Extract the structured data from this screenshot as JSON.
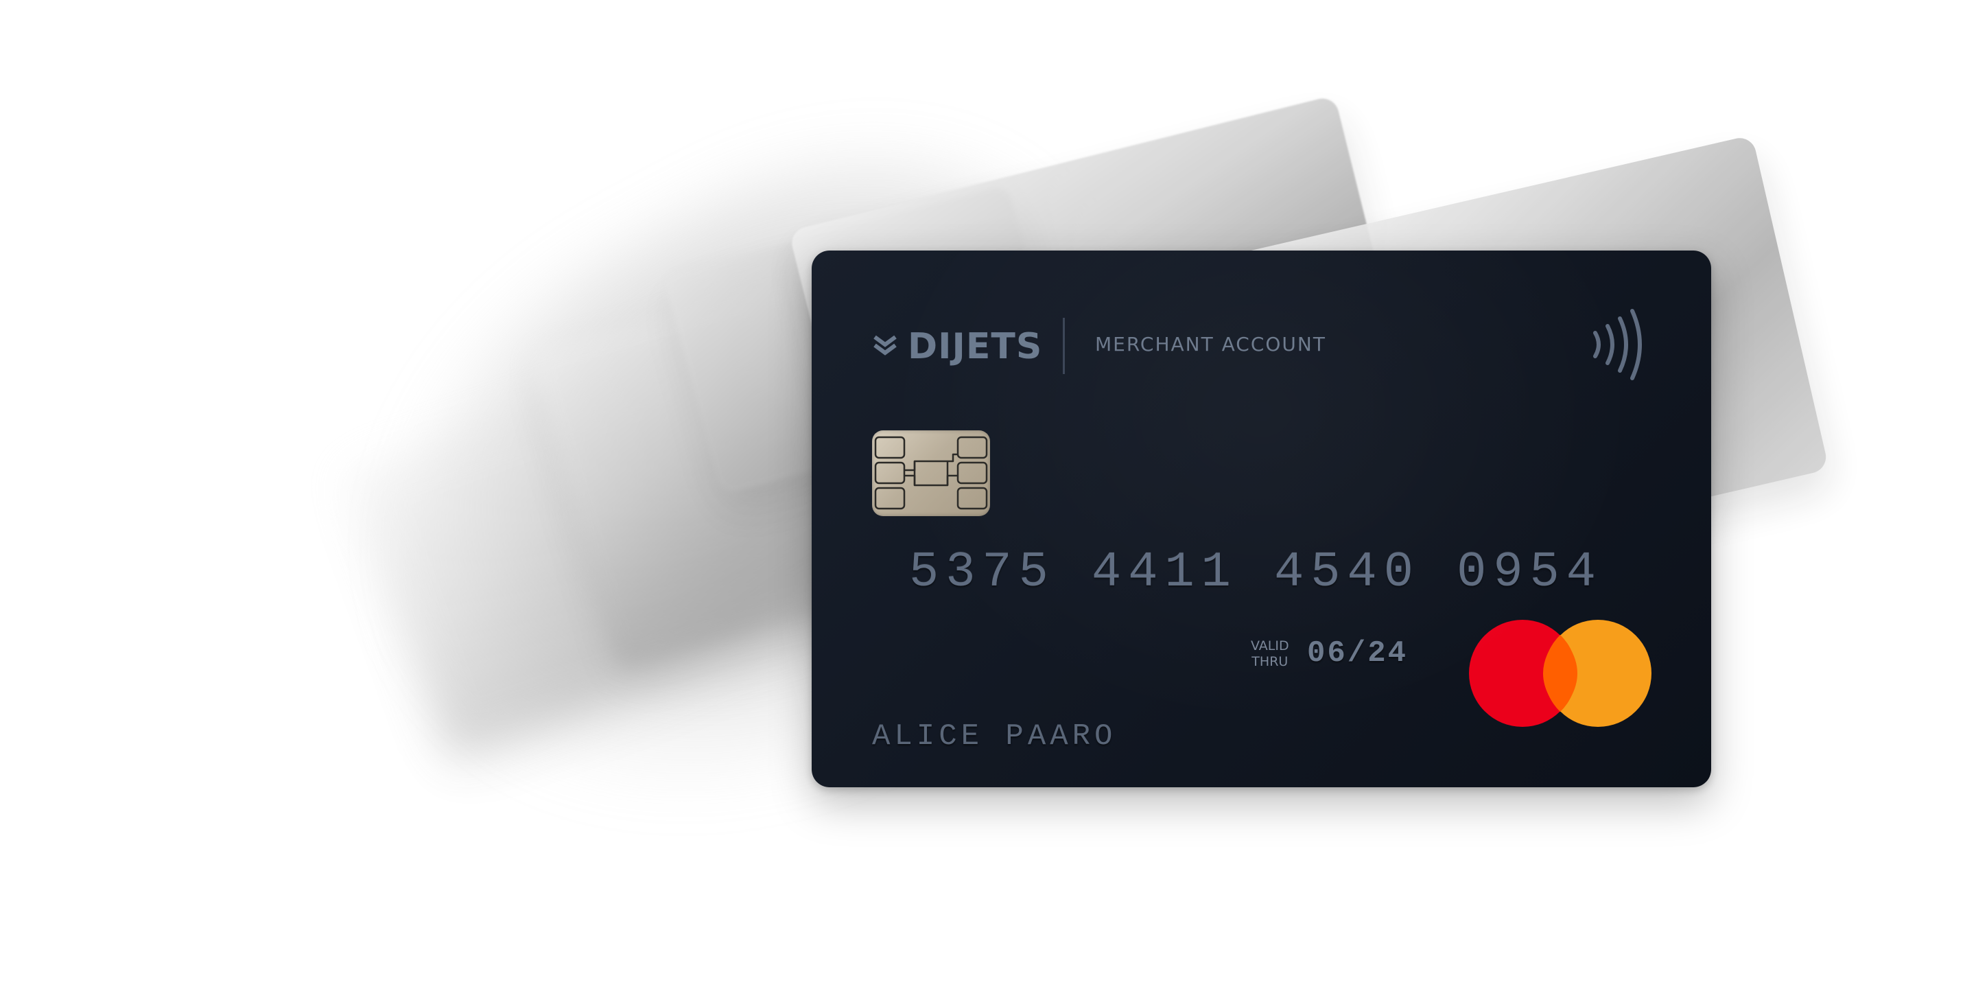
{
  "card": {
    "brand_name": "DIJETS",
    "account_type": "MERCHANT ACCOUNT",
    "number": "5375 4411 4540 0954",
    "valid_label_line1": "VALID",
    "valid_label_line2": "THRU",
    "expiry": "06/24",
    "cardholder": "ALICE PAARO",
    "network": "mastercard",
    "colors": {
      "card_background": "#121823",
      "text_engraved": "#5f6c80",
      "chip_gold": "#b9ae9a",
      "mastercard_red": "#eb001b",
      "mastercard_orange": "#f79e1b",
      "mastercard_overlap": "#ff5f00"
    }
  },
  "icons": {
    "brand_logo": "layers-chevron-icon",
    "contactless": "contactless-payment-icon",
    "chip": "emv-chip-icon",
    "network_logo": "mastercard-logo-icon"
  }
}
